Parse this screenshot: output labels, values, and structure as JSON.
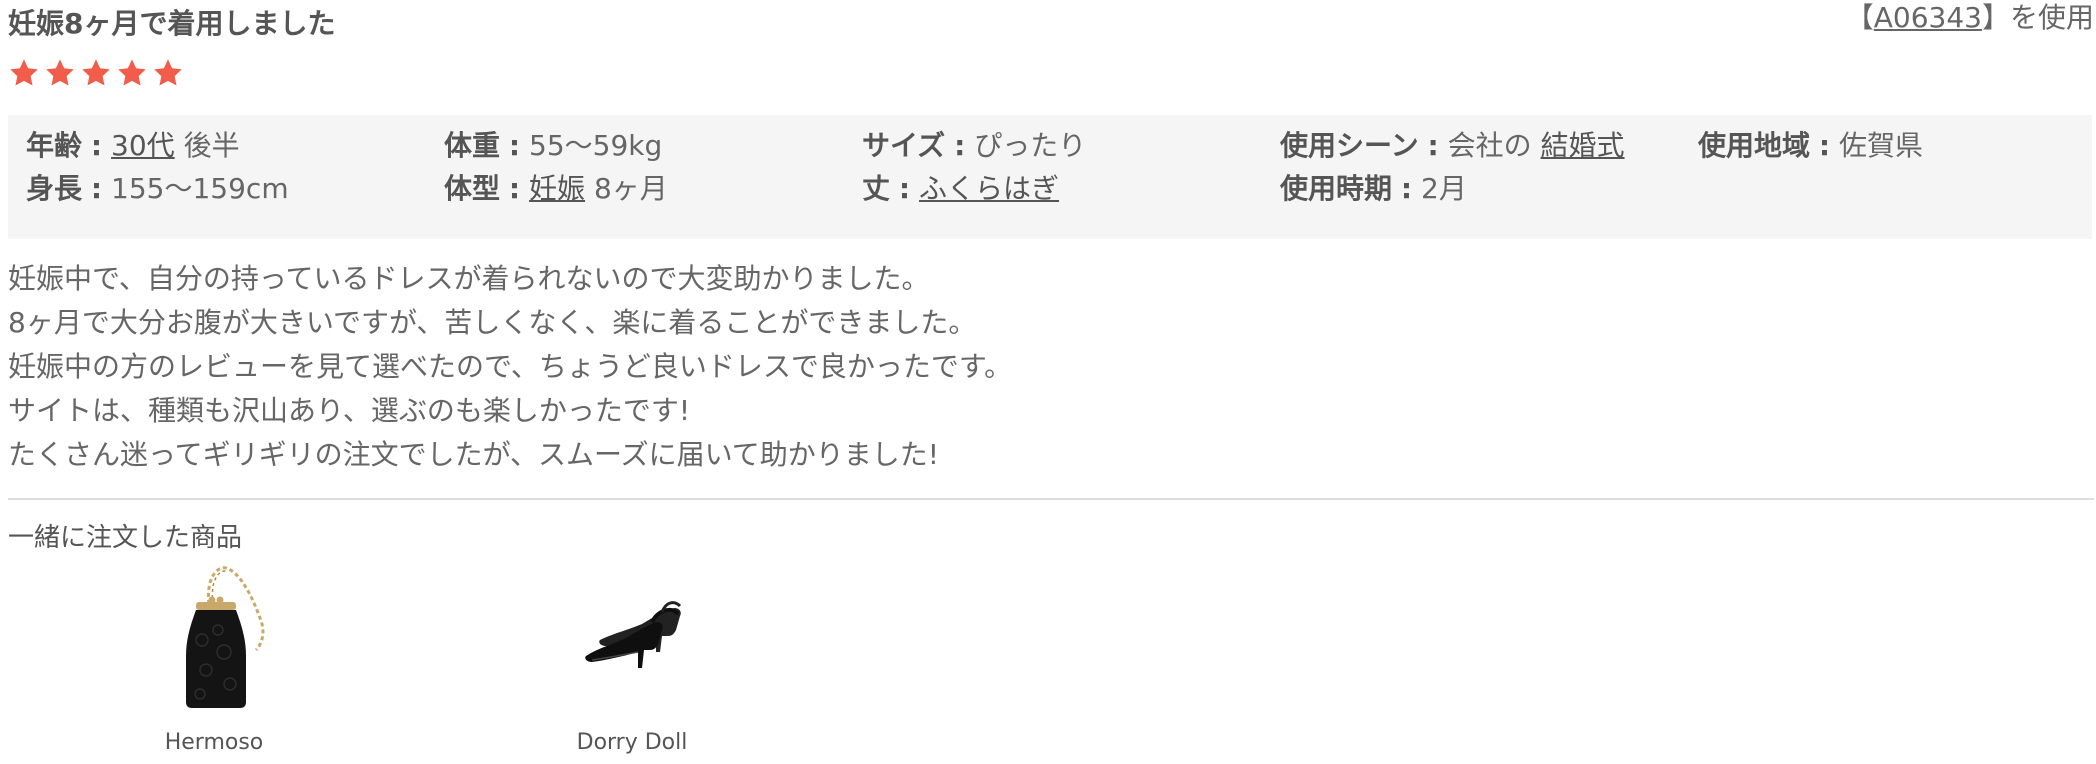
{
  "review": {
    "title": "妊娠8ヶ月で着用しました",
    "used_prefix": "【",
    "used_code": "A06343",
    "used_suffix": "】を使用",
    "rating": 5,
    "rating_max": 5,
    "star_color": "#f25c4b",
    "attributes": {
      "age": {
        "label": "年齢",
        "colon": ":",
        "value_link": "30代",
        "value_suffix": "後半"
      },
      "weight": {
        "label": "体重",
        "colon": ":",
        "value": "55〜59kg"
      },
      "size": {
        "label": "サイズ",
        "colon": ":",
        "value": "ぴったり"
      },
      "scene": {
        "label": "使用シーン",
        "colon": ":",
        "value_prefix": "会社の",
        "value_link": "結婚式"
      },
      "region": {
        "label": "使用地域",
        "colon": ":",
        "value": "佐賀県"
      },
      "height": {
        "label": "身長",
        "colon": ":",
        "value": "155〜159cm"
      },
      "body_type": {
        "label": "体型",
        "colon": ":",
        "value_link": "妊娠",
        "value_suffix": "8ヶ月"
      },
      "length": {
        "label": "丈",
        "colon": ":",
        "value_link": "ふくらはぎ"
      },
      "period": {
        "label": "使用時期",
        "colon": ":",
        "value": "2月"
      }
    },
    "body_lines": [
      "妊娠中で、自分の持っているドレスが着られないので大変助かりました。",
      "8ヶ月で大分お腹が大きいですが、苦しくなく、楽に着ることができました。",
      "妊娠中の方のレビューを見て選べたので、ちょうど良いドレスで良かったです。",
      "サイトは、種類も沢山あり、選ぶのも楽しかったです!",
      "たくさん迷ってギリギリの注文でしたが、スムーズに届いて助かりました!"
    ]
  },
  "ordered_together": {
    "title": "一緒に注文した商品",
    "items": [
      {
        "name": "Hermoso",
        "icon": "black-lace-clutch-bag-icon"
      },
      {
        "name": "Dorry Doll",
        "icon": "black-pump-shoes-icon"
      }
    ]
  }
}
